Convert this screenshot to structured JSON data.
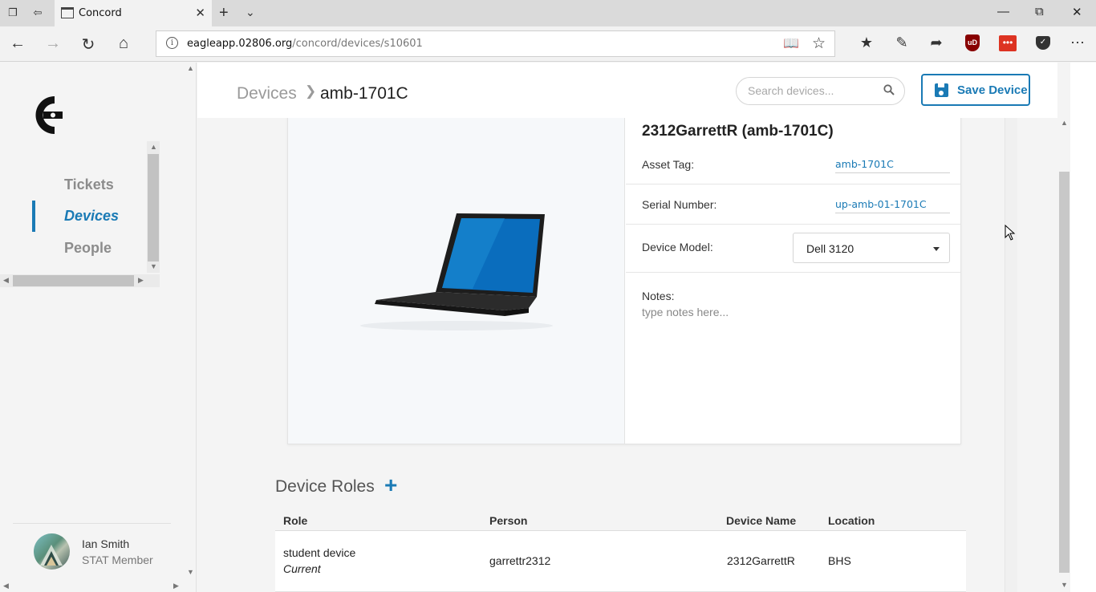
{
  "browser": {
    "tab_title": "Concord",
    "url_host": "eagleapp.02806.org",
    "url_path": "/concord/devices/s10601"
  },
  "sidebar": {
    "items": [
      {
        "label": "Tickets",
        "active": false
      },
      {
        "label": "Devices",
        "active": true
      },
      {
        "label": "People",
        "active": false
      }
    ],
    "user": {
      "name": "Ian Smith",
      "role": "STAT Member"
    }
  },
  "header": {
    "breadcrumb_root": "Devices",
    "breadcrumb_current": "amb-1701C",
    "search_placeholder": "Search devices...",
    "save_label": "Save Device"
  },
  "device": {
    "title": "2312GarrettR (amb-1701C)",
    "asset_tag_label": "Asset Tag:",
    "asset_tag": "amb-1701C",
    "serial_label": "Serial Number:",
    "serial": "up-amb-01-1701C",
    "model_label": "Device Model:",
    "model": "Dell 3120",
    "notes_label": "Notes:",
    "notes_placeholder": "type notes here..."
  },
  "roles": {
    "title": "Device Roles",
    "add_symbol": "+",
    "columns": [
      "Role",
      "Person",
      "Device Name",
      "Location"
    ],
    "rows": [
      {
        "role": "student device",
        "status": "Current",
        "person": "garrettr2312",
        "device_name": "2312GarrettR",
        "location": "BHS"
      }
    ]
  },
  "colors": {
    "accent": "#1a7ab5",
    "sidebar_bg": "#f4f4f4"
  }
}
